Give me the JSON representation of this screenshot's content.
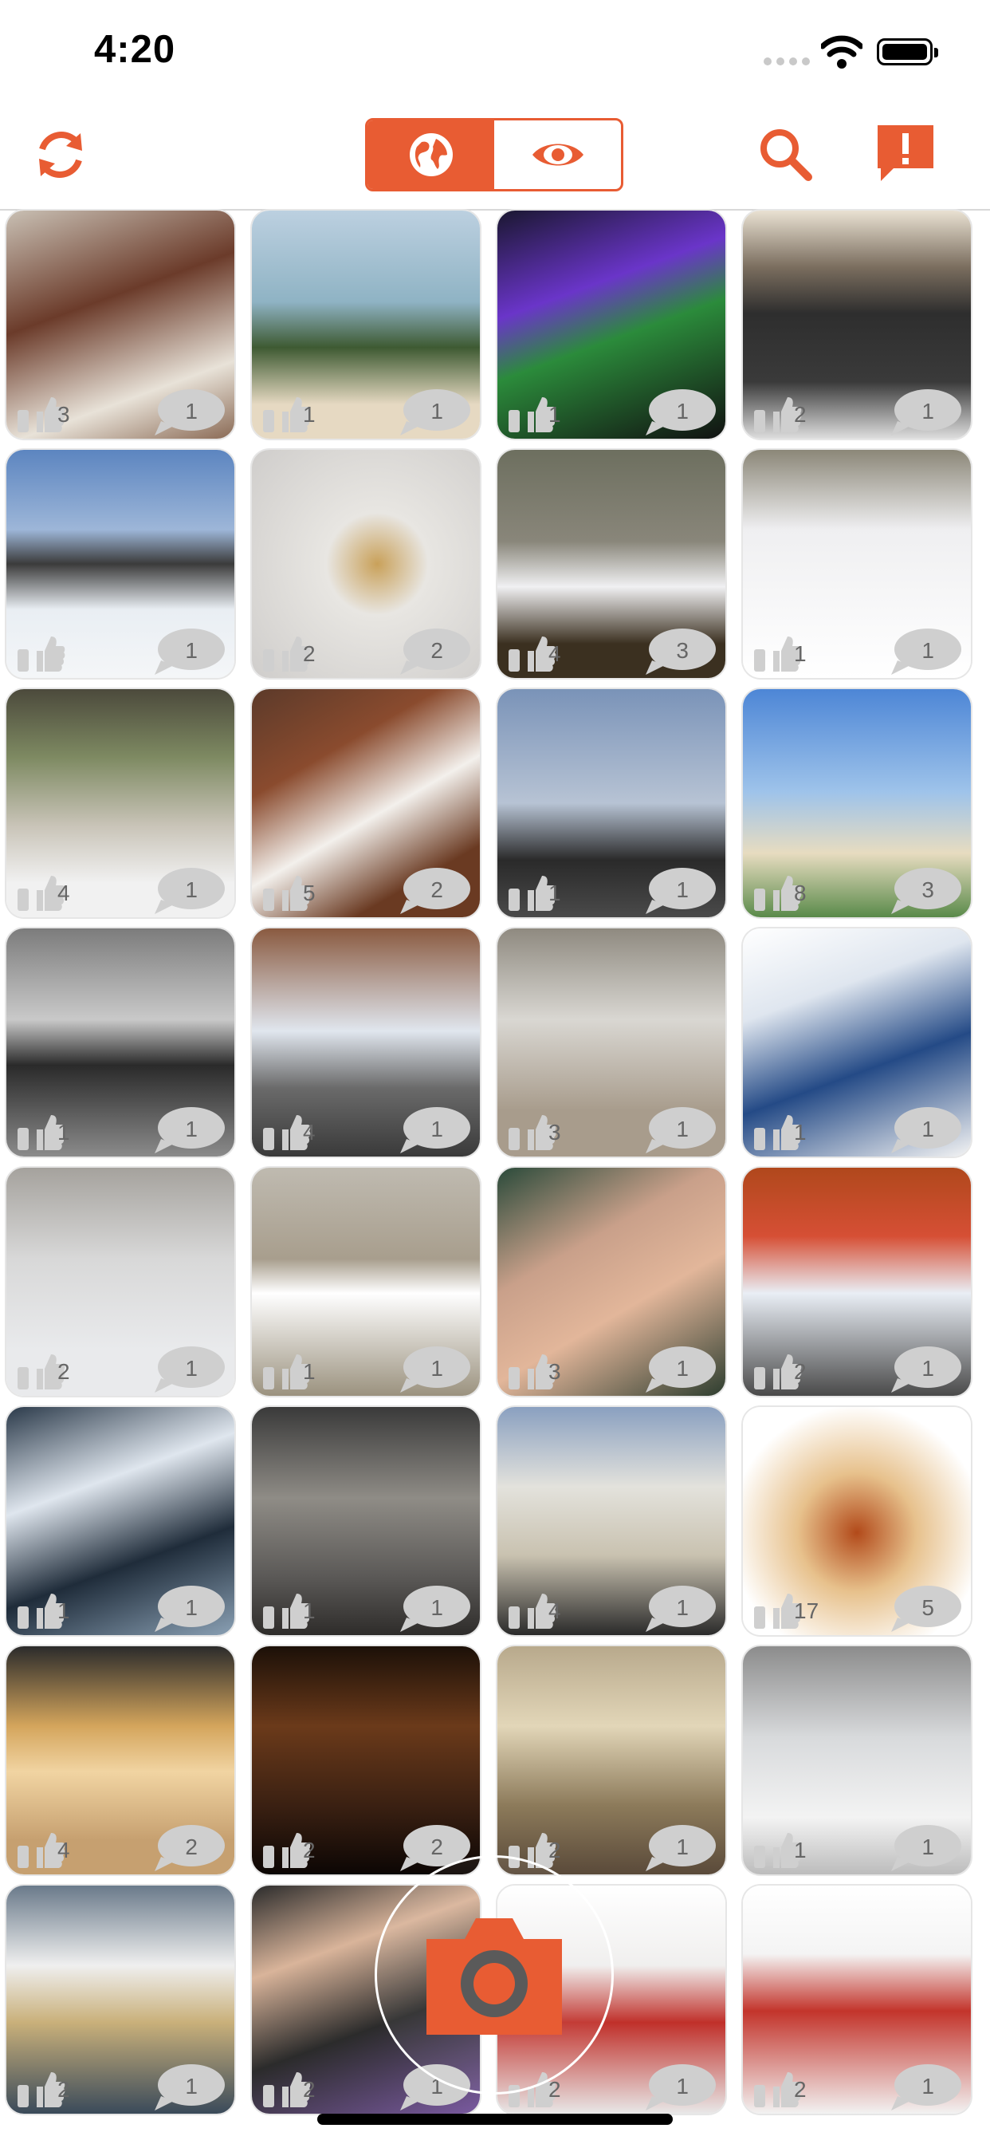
{
  "status_bar": {
    "time": "4:20"
  },
  "accent_color": "#e85c33",
  "nav": {
    "icons": [
      "refresh-icon",
      "globe-icon",
      "eye-icon",
      "search-icon",
      "report-icon"
    ],
    "segmented": {
      "selected": "globe"
    }
  },
  "photos": [
    {
      "likes": "3",
      "comments": "1"
    },
    {
      "likes": "1",
      "comments": "1"
    },
    {
      "likes": "1",
      "comments": "1"
    },
    {
      "likes": "2",
      "comments": "1"
    },
    {
      "likes": "",
      "comments": "1"
    },
    {
      "likes": "2",
      "comments": "2"
    },
    {
      "likes": "4",
      "comments": "3"
    },
    {
      "likes": "1",
      "comments": "1"
    },
    {
      "likes": "4",
      "comments": "1"
    },
    {
      "likes": "5",
      "comments": "2"
    },
    {
      "likes": "1",
      "comments": "1"
    },
    {
      "likes": "8",
      "comments": "3"
    },
    {
      "likes": "1",
      "comments": "1"
    },
    {
      "likes": "4",
      "comments": "1"
    },
    {
      "likes": "3",
      "comments": "1"
    },
    {
      "likes": "1",
      "comments": "1"
    },
    {
      "likes": "2",
      "comments": "1"
    },
    {
      "likes": "1",
      "comments": "1"
    },
    {
      "likes": "3",
      "comments": "1"
    },
    {
      "likes": "2",
      "comments": "1"
    },
    {
      "likes": "1",
      "comments": "1"
    },
    {
      "likes": "1",
      "comments": "1"
    },
    {
      "likes": "4",
      "comments": "1"
    },
    {
      "likes": "17",
      "comments": "5"
    },
    {
      "likes": "4",
      "comments": "2"
    },
    {
      "likes": "2",
      "comments": "2"
    },
    {
      "likes": "2",
      "comments": "1"
    },
    {
      "likes": "1",
      "comments": "1"
    },
    {
      "likes": "2",
      "comments": "1"
    },
    {
      "likes": "2",
      "comments": "1"
    },
    {
      "likes": "2",
      "comments": "1"
    },
    {
      "likes": "2",
      "comments": "1"
    }
  ],
  "camera": {
    "icon": "camera-icon"
  }
}
